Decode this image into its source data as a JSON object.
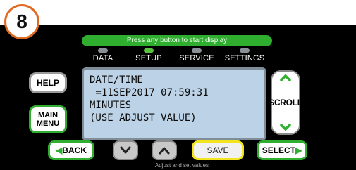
{
  "step_badge": "8",
  "banner": "Press any button to start display",
  "tabs": [
    {
      "label": "DATA",
      "active": false
    },
    {
      "label": "SETUP",
      "active": true
    },
    {
      "label": "SERVICE",
      "active": false
    },
    {
      "label": "SETTINGS",
      "active": false
    }
  ],
  "left_buttons": {
    "help": "HELP",
    "main_menu_line1": "MAIN",
    "main_menu_line2": "MENU"
  },
  "lcd": {
    "line1": "DATE/TIME",
    "line2": " =11SEP2017 07:59:31",
    "line3": "MINUTES",
    "line4": "(USE ADJUST VALUE)"
  },
  "scroll_label": "SCROLL",
  "bottom_buttons": {
    "back": "BACK",
    "save": "SAVE",
    "select": "SELECT"
  },
  "caption": "Adjust and set values",
  "colors": {
    "accent_green": "#2fae2f",
    "highlight_yellow": "#f2e51f",
    "step_orange": "#e06a22",
    "lcd_bg": "#bcd2e6"
  },
  "icons": {
    "down": "chevron-down-icon",
    "up": "chevron-up-icon",
    "back": "triangle-left-icon",
    "select": "triangle-right-icon"
  }
}
